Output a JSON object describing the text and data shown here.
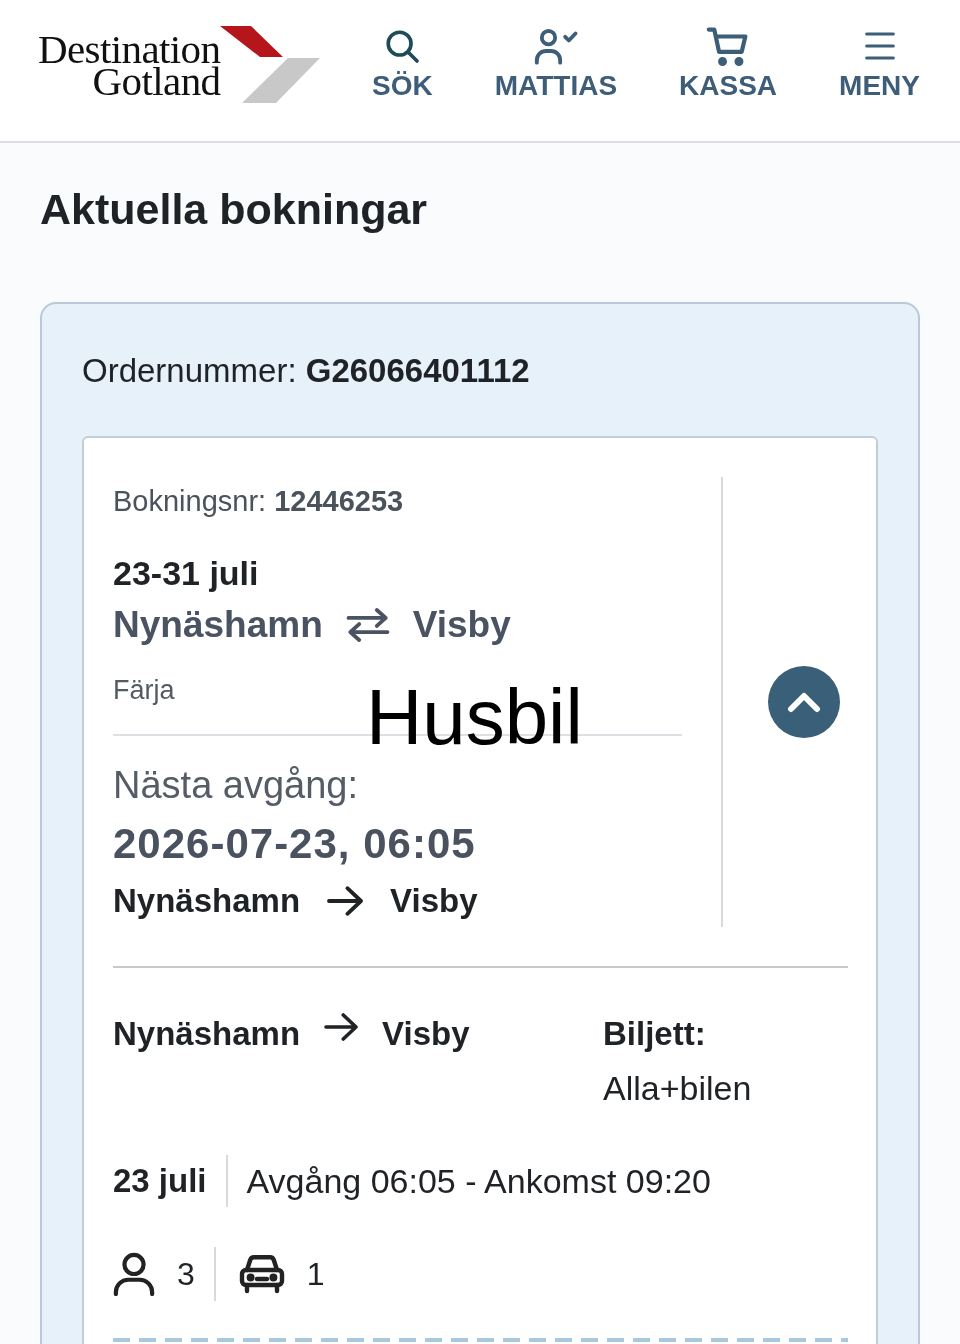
{
  "header": {
    "logo": {
      "lines": [
        "Destination",
        "Gotland"
      ]
    },
    "nav": [
      {
        "kind": "search",
        "label": "SÖK"
      },
      {
        "kind": "account",
        "label": "MATTIAS"
      },
      {
        "kind": "cart",
        "label": "KASSA"
      },
      {
        "kind": "menu",
        "label": "MENY"
      }
    ]
  },
  "page_title": "Aktuella bokningar",
  "order": {
    "number_line": "Ordernummer: **G26066401112**",
    "booking": {
      "number_line": "Bokningsnr: **12446253**",
      "dates": "23-31 juli",
      "route": {
        "from": "Nynäshamn",
        "to": "Visby"
      },
      "transport": "Färja",
      "overlay_text": "Husbil",
      "next_departure": {
        "label": "Nästa avgång:",
        "datetime": "2026-07-23, 06:05",
        "from": "Nynäshamn",
        "to": "Visby"
      },
      "expanded": true,
      "legs": [
        {
          "from": "Nynäshamn",
          "to": "Visby",
          "ticket_label": "Biljett:",
          "ticket": "Alla+bilen",
          "date": "23 juli",
          "times": "Avgång 06:05 - Ankomst 09:20",
          "passengers": "3",
          "vehicles": "1"
        }
      ]
    }
  }
}
